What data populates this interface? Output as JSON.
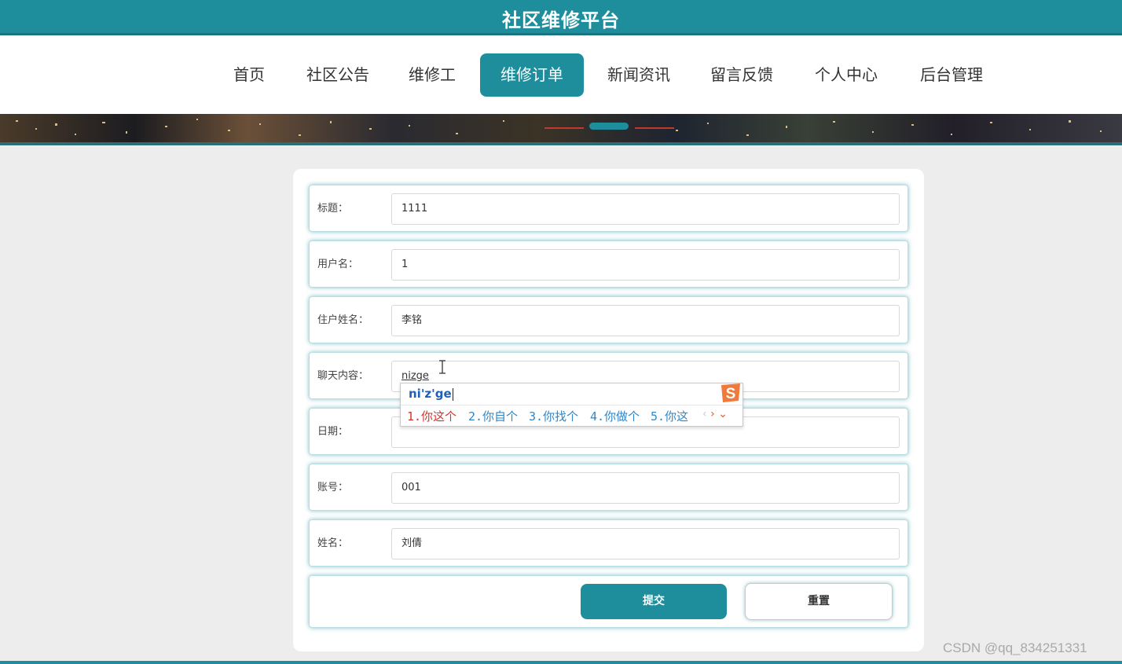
{
  "header": {
    "title": "社区维修平台"
  },
  "nav": {
    "items": [
      {
        "label": "首页"
      },
      {
        "label": "社区公告"
      },
      {
        "label": "维修工"
      },
      {
        "label": "维修订单"
      },
      {
        "label": "新闻资讯"
      },
      {
        "label": "留言反馈"
      },
      {
        "label": "个人中心"
      },
      {
        "label": "后台管理"
      }
    ],
    "active": "维修订单"
  },
  "form": {
    "fields": [
      {
        "label": "标题：",
        "value": "1111"
      },
      {
        "label": "用户名：",
        "value": "1"
      },
      {
        "label": "住户姓名：",
        "value": "李铭"
      },
      {
        "label": "聊天内容：",
        "value": "nizge"
      },
      {
        "label": "日期：",
        "value": ""
      },
      {
        "label": "账号：",
        "value": "001"
      },
      {
        "label": "姓名：",
        "value": "刘倩"
      }
    ],
    "submit_label": "提交",
    "reset_label": "重置"
  },
  "ime": {
    "pinyin": "ni'z'ge",
    "candidates": [
      "1.你这个",
      "2.你自个",
      "3.你找个",
      "4.你做个",
      "5.你这"
    ],
    "logo_letter": "S"
  },
  "watermark": "CSDN @qq_834251331",
  "colors": {
    "accent": "#1f8e9c",
    "candidate_first": "#d0342c",
    "candidate": "#2f86c8"
  }
}
